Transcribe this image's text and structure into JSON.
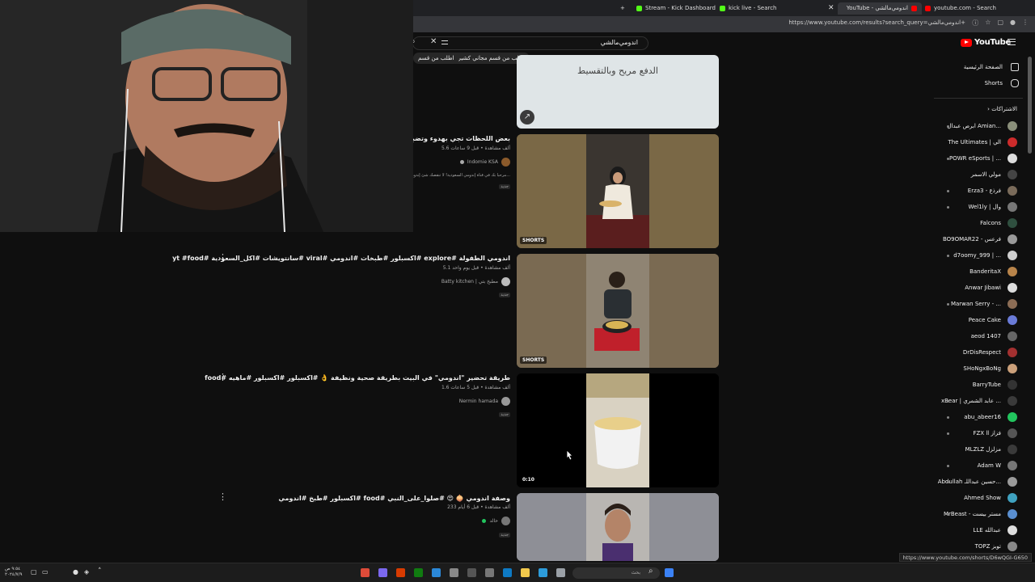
{
  "browser": {
    "tabs": [
      {
        "label": "Stream - Kick Dashboard",
        "favicon_color": "#53fc18"
      },
      {
        "label": "kick live - Search",
        "favicon_color": "#53fc18"
      },
      {
        "label": "YouTube - اندومي‌مالشي",
        "favicon_color": "#ff0000",
        "active": true
      },
      {
        "label": "youtube.com - Search",
        "favicon_color": "#ff0000"
      }
    ],
    "new_tab": "+",
    "url": "https://www.youtube.com/results?search_query=اندومي‌مالشي+",
    "status_url": "https://www.youtube.com/shorts/D6wQGI-G650"
  },
  "youtube": {
    "logo": "YouTube",
    "search": {
      "query": "اندومي‌مالشي"
    },
    "chips": [
      "اطلب من قسم مجاني كشيري",
      "اطلب من قسم"
    ],
    "sidebar": {
      "nav": [
        {
          "label": "الصفحة الرئيسية",
          "icon": "home-icon"
        },
        {
          "label": "Shorts",
          "icon": "shorts-icon"
        }
      ],
      "subs_header": "الاشتراكات",
      "subscriptions": [
        {
          "name": "ابرص عبدال Amian...",
          "color": "#8a8f7a",
          "dot": true
        },
        {
          "name": "The Ultimates | الي",
          "color": "#cc2b2b",
          "dot": false
        },
        {
          "name": "POWR eSports | ...",
          "color": "#dddddd",
          "dot": true
        },
        {
          "name": "مولي الاسمر",
          "color": "#444444",
          "dot": false
        },
        {
          "name": "Erza3 - فرذع",
          "color": "#7a6b5a",
          "dot": true
        },
        {
          "name": "Wel1ly | وال",
          "color": "#777777",
          "dot": true
        },
        {
          "name": "Falcons",
          "color": "#2f4f3f",
          "dot": false
        },
        {
          "name": "BO9OMAR22 - فرعس",
          "color": "#999999",
          "dot": false
        },
        {
          "name": "d7oomy_999 | ...",
          "color": "#cfcfcf",
          "dot": true
        },
        {
          "name": "BanderitaX",
          "color": "#b8844a",
          "dot": false
        },
        {
          "name": "Anwar Jibawi",
          "color": "#dddddd",
          "dot": false
        },
        {
          "name": "Marwan Serry - ...",
          "color": "#8c6d55",
          "dot": true
        },
        {
          "name": "Peace Cake",
          "color": "#6a7bd8",
          "dot": false
        },
        {
          "name": "aeod 1407",
          "color": "#666666",
          "dot": false
        },
        {
          "name": "DrDisRespect",
          "color": "#a33030",
          "dot": false
        },
        {
          "name": "SHoNgxBoNg",
          "color": "#cba07a",
          "dot": false
        },
        {
          "name": "BarryTube",
          "color": "#333333",
          "dot": false
        },
        {
          "name": "xBear | عابد الشمري ...",
          "color": "#3a3a3a",
          "dot": true
        },
        {
          "name": "abu_abeer16",
          "color": "#22c55e",
          "dot": true
        },
        {
          "name": "FZX ll فزاز",
          "color": "#555555",
          "dot": true
        },
        {
          "name": "MLZLZ مزلزل",
          "color": "#3a3a3a",
          "dot": false
        },
        {
          "name": "Adam W",
          "color": "#777777",
          "dot": true
        },
        {
          "name": "Abdullah حسين عبداللـ...",
          "color": "#9a9a9a",
          "dot": true
        },
        {
          "name": "Ahmed Show",
          "color": "#3fa2c0",
          "dot": false
        },
        {
          "name": "MrBeast - مستر بيست",
          "color": "#5a8fd0",
          "dot": true
        },
        {
          "name": "LLE عبدالله",
          "color": "#dddddd",
          "dot": false
        },
        {
          "name": "TOPZ توبز",
          "color": "#888888",
          "dot": false
        }
      ]
    },
    "results": [
      {
        "title": "",
        "overlay_text": "الدفع مريح وبالتقسيط",
        "badge": ""
      },
      {
        "title": "بعض اللحظات تجي بهدوء وتضبط كل شي",
        "meta": "5.6 ألف مشاهدة • قبل 9 ساعات",
        "channel": "Indomie KSA",
        "channel_color": "#8b5a2b",
        "desc": "مرحبا بك في قناة إندومي السعودية! لا تنقصك شئ إندومي...",
        "tag": "جديد",
        "badge": "SHORTS"
      },
      {
        "title": "اندومي الطفولة #explore #اكسبلور #طبخات #اندومي #viral #سانتويشات #اكل_السعودية #yt #food",
        "meta": "5.1 ألف مشاهدة • قبل يوم واحد",
        "channel": "Batty kitchen | مطبخ بتي",
        "channel_color": "#bbbbbb",
        "tag": "جديد",
        "badge": "SHORTS"
      },
      {
        "title": "طريقة تحضير \"اندومي\" في البيت بطريقة صحية ونظيفة 👌 #اكسبلور #اكسبلور #ماهيه #food",
        "meta": "1.6 ألف مشاهدة • قبل 5 ساعات",
        "channel": "Nermin hamada",
        "channel_color": "#999999",
        "tag": "جديد",
        "badge": "0:10"
      },
      {
        "title": "وصفة اندومي 🧅 😍 #صلوا_على_النبي #food #اكسبلور #طبخ #اندومي",
        "meta": "233 ألف مشاهدة • قبل 6 أيام",
        "channel": "حالد",
        "channel_color": "#777777",
        "tag": "جديد",
        "badge": ""
      }
    ]
  },
  "taskbar": {
    "clock": [
      "٩:٥٤ ص",
      "٢٠٢٤/٧/٩"
    ],
    "search_placeholder": "بحث",
    "icons": [
      {
        "name": "chrome-icon",
        "color": "#dd4b39"
      },
      {
        "name": "app-icon",
        "color": "#7b68ee"
      },
      {
        "name": "word-icon",
        "color": "#d83b01"
      },
      {
        "name": "xbox-icon",
        "color": "#107c10"
      },
      {
        "name": "shield-icon",
        "color": "#2b88d8"
      },
      {
        "name": "settings-icon",
        "color": "#888888"
      },
      {
        "name": "obs-icon",
        "color": "#555555"
      },
      {
        "name": "files-icon",
        "color": "#777777"
      },
      {
        "name": "edge-icon",
        "color": "#0e7ac4"
      },
      {
        "name": "folder-icon",
        "color": "#f2c94c"
      },
      {
        "name": "photos-icon",
        "color": "#2d9cdb"
      },
      {
        "name": "window-icon",
        "color": "#9aa0a6"
      },
      {
        "name": "store-icon",
        "color": "#3b82f6"
      }
    ]
  }
}
